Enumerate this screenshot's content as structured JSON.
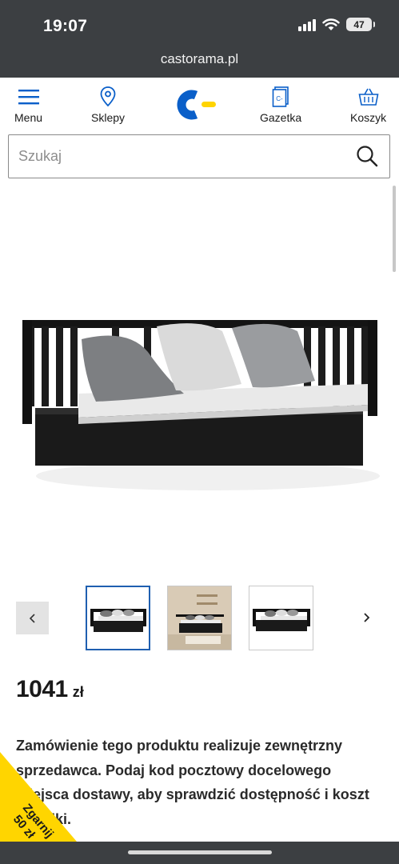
{
  "status": {
    "time": "19:07",
    "battery": "47"
  },
  "browser": {
    "url": "castorama.pl"
  },
  "nav": {
    "menu": "Menu",
    "stores": "Sklepy",
    "catalog": "Gazetka",
    "cart": "Koszyk"
  },
  "search": {
    "placeholder": "Szukaj"
  },
  "product": {
    "price_value": "1041",
    "price_currency": "zł",
    "description": "Zamówienie tego produktu realizuje zewnętrzny sprzedawca. Podaj kod pocztowy docelowego miejsca dostawy, aby sprawdzić dostępność i koszt wysyłki."
  },
  "promo": {
    "line1": "Zgarnij",
    "line2": "50 zł"
  },
  "colors": {
    "brand_blue": "#0a5fc9",
    "brand_yellow": "#ffd400",
    "promo_yellow": "#ffd500",
    "chrome_dark": "#3c3f42"
  },
  "icons": [
    "hamburger-icon",
    "location-pin-icon",
    "catalog-icon",
    "basket-icon",
    "search-icon",
    "chevron-left-icon",
    "chevron-right-icon"
  ]
}
